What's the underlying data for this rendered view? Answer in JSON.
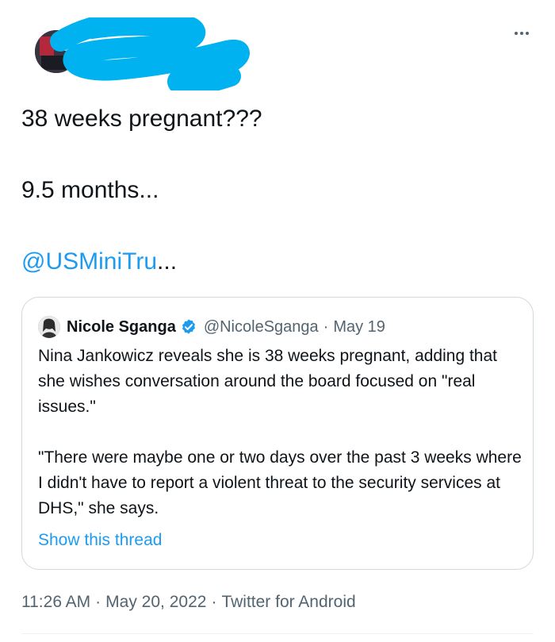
{
  "tweet": {
    "text_line_1": "38 weeks pregnant???",
    "text_line_2": "9.5 months...",
    "mention": "@USMiniTru",
    "mention_suffix": "...",
    "timestamp_time": "11:26 AM",
    "timestamp_date": "May 20, 2022",
    "source": "Twitter for Android",
    "separator": "·"
  },
  "quoted_tweet": {
    "author_name": "Nicole Sganga",
    "author_handle": "@NicoleSganga",
    "separator": "·",
    "date": "May 19",
    "paragraph_1": "Nina Jankowicz reveals she is 38 weeks pregnant, adding that she wishes conversation around the board focused on \"real issues.\"",
    "paragraph_2": "\"There were maybe one or two days over the past 3 weeks where I didn't have to report a violent threat to the security services at DHS,\" she says.",
    "show_thread_label": "Show this thread"
  },
  "icons": {
    "more": "more-horizontal-icon",
    "verified": "verified-badge-icon"
  },
  "colors": {
    "link": "#1d9bf0",
    "secondary_text": "#536471",
    "primary_text": "#0f1419",
    "verified": "#1d9bf0",
    "border": "#cfd9de",
    "redaction": "#00b2f0"
  }
}
